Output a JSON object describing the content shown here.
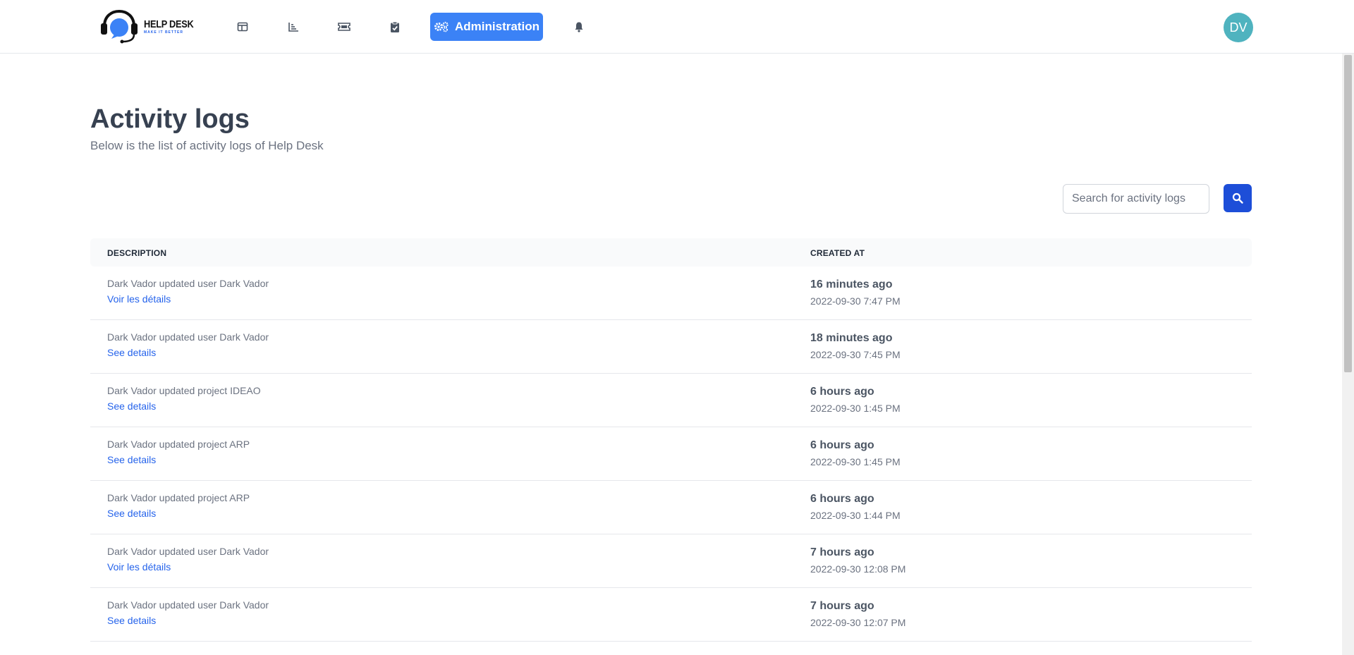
{
  "brand": {
    "title": "HELP DESK",
    "tagline": "MAKE IT BETTER"
  },
  "nav": {
    "icons": [
      "layout-icon",
      "chart-icon",
      "ticket-icon",
      "clipboard-check-icon"
    ],
    "admin_label": "Administration",
    "notification_icon": "bell-icon",
    "avatar_initials": "DV"
  },
  "page": {
    "title": "Activity logs",
    "subtitle": "Below is the list of activity logs of Help Desk"
  },
  "search": {
    "placeholder": "Search for activity logs"
  },
  "table": {
    "headers": {
      "description": "DESCRIPTION",
      "created_at": "CREATED AT"
    },
    "rows": [
      {
        "description": "Dark Vador updated user Dark Vador",
        "link": "Voir les détails",
        "relative": "16 minutes ago",
        "absolute": "2022-09-30 7:47 PM"
      },
      {
        "description": "Dark Vador updated user Dark Vador",
        "link": "See details",
        "relative": "18 minutes ago",
        "absolute": "2022-09-30 7:45 PM"
      },
      {
        "description": "Dark Vador updated project IDEAO",
        "link": "See details",
        "relative": "6 hours ago",
        "absolute": "2022-09-30 1:45 PM"
      },
      {
        "description": "Dark Vador updated project ARP",
        "link": "See details",
        "relative": "6 hours ago",
        "absolute": "2022-09-30 1:45 PM"
      },
      {
        "description": "Dark Vador updated project ARP",
        "link": "See details",
        "relative": "6 hours ago",
        "absolute": "2022-09-30 1:44 PM"
      },
      {
        "description": "Dark Vador updated user Dark Vador",
        "link": "Voir les détails",
        "relative": "7 hours ago",
        "absolute": "2022-09-30 12:08 PM"
      },
      {
        "description": "Dark Vador updated user Dark Vador",
        "link": "See details",
        "relative": "7 hours ago",
        "absolute": "2022-09-30 12:07 PM"
      }
    ]
  },
  "colors": {
    "accent": "#3b82f6",
    "accent_dark": "#1d4ed8",
    "link": "#2563eb",
    "avatar": "#4fb3bf"
  }
}
